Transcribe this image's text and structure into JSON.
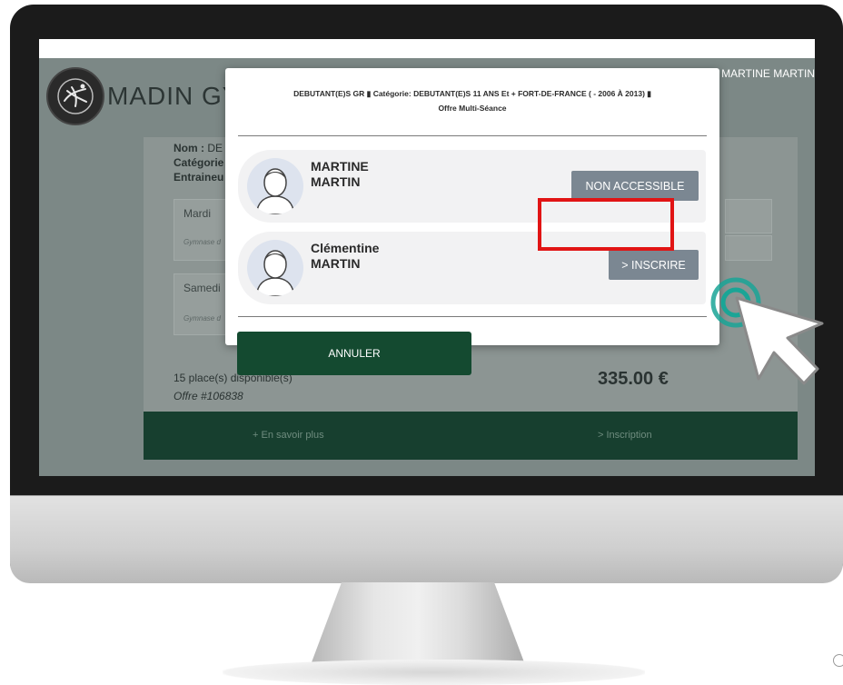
{
  "header": {
    "brand": "MADIN GY",
    "user": "MARTINE MARTIN"
  },
  "course": {
    "nom_label": "Nom :",
    "nom_value": "DE",
    "categorie_label": "Catégorie",
    "entraineur_label": "Entraineu",
    "slots": [
      {
        "day": "Mardi",
        "gym": "Gymnase d"
      },
      {
        "day": "Samedi",
        "gym": "Gymnase d"
      }
    ],
    "places": "15 place(s) disponible(s)",
    "offre": "Offre #106838",
    "price": "335.00 €",
    "footer_more": "+  En savoir plus",
    "footer_inscription": ">  Inscription"
  },
  "modal": {
    "title_line1": "DEBUTANT(E)S GR  ▮  Catégorie: DEBUTANT(E)S 11 ANS Et + FORT-DE-FRANCE ( - 2006 À 2013)  ▮",
    "title_line2": "Offre Multi-Séance",
    "persons": [
      {
        "first": "MARTINE",
        "last": "MARTIN",
        "action": "NON ACCESSIBLE"
      },
      {
        "first": "Clémentine",
        "last": "MARTIN",
        "action": "> INSCRIRE"
      }
    ],
    "cancel": "ANNULER"
  },
  "colors": {
    "overlay": "#7c8886",
    "footer_green": "#173f2f",
    "cancel_green": "#144a30",
    "button_grey": "#7b8792",
    "highlight_red": "#e11414",
    "click_teal": "#1aa596"
  }
}
